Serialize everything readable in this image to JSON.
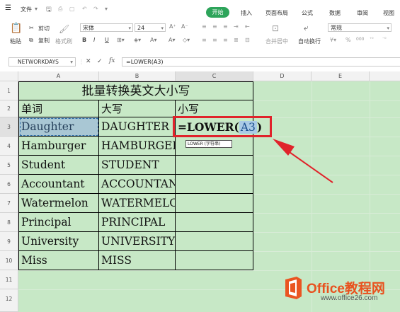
{
  "menubar": {
    "menu_icon": "☰",
    "file": "文件",
    "tabs": [
      "开始",
      "插入",
      "页面布局",
      "公式",
      "数据",
      "审阅",
      "视图"
    ]
  },
  "ribbon": {
    "paste": "粘贴",
    "cut": "剪切",
    "copy": "复制",
    "format_painter": "格式刷",
    "font_name": "宋体",
    "font_size": "24",
    "bold": "B",
    "italic": "I",
    "underline": "U",
    "merge_center": "合并居中",
    "wrap_text": "自动换行",
    "number_format": "常规",
    "percent": "%",
    "thousands": "000"
  },
  "formula_bar": {
    "name_box": "NETWORKDAYS",
    "cancel": "✕",
    "confirm": "✓",
    "fx": "fx",
    "formula": "=LOWER(A3)"
  },
  "columns": [
    "A",
    "B",
    "C",
    "D",
    "E"
  ],
  "rows": [
    "1",
    "2",
    "3",
    "4",
    "5",
    "6",
    "7",
    "8",
    "9",
    "10",
    "11",
    "12"
  ],
  "table": {
    "title": "批量转换英文大小写",
    "headers": [
      "单词",
      "大写",
      "小写"
    ],
    "data": [
      [
        "Daughter",
        "DAUGHTER"
      ],
      [
        "Hamburger",
        "HAMBURGER"
      ],
      [
        "Student",
        "STUDENT"
      ],
      [
        "Accountant",
        "ACCOUNTANT"
      ],
      [
        "Watermelon",
        "WATERMELON"
      ],
      [
        "Principal",
        "PRINCIPAL"
      ],
      [
        "University",
        "UNIVERSITY"
      ],
      [
        "Miss",
        "MISS"
      ]
    ],
    "editing_formula_prefix": "=LOWER(",
    "editing_formula_arg": "A3",
    "editing_formula_suffix": ")",
    "tooltip": "LOWER (字符串)"
  },
  "watermark": {
    "brand": "Office教程网",
    "url": "www.office26.com"
  },
  "colors": {
    "accent_green": "#2da45a",
    "sheet_bg": "#c7e8c6",
    "highlight_red": "#e0232b"
  }
}
